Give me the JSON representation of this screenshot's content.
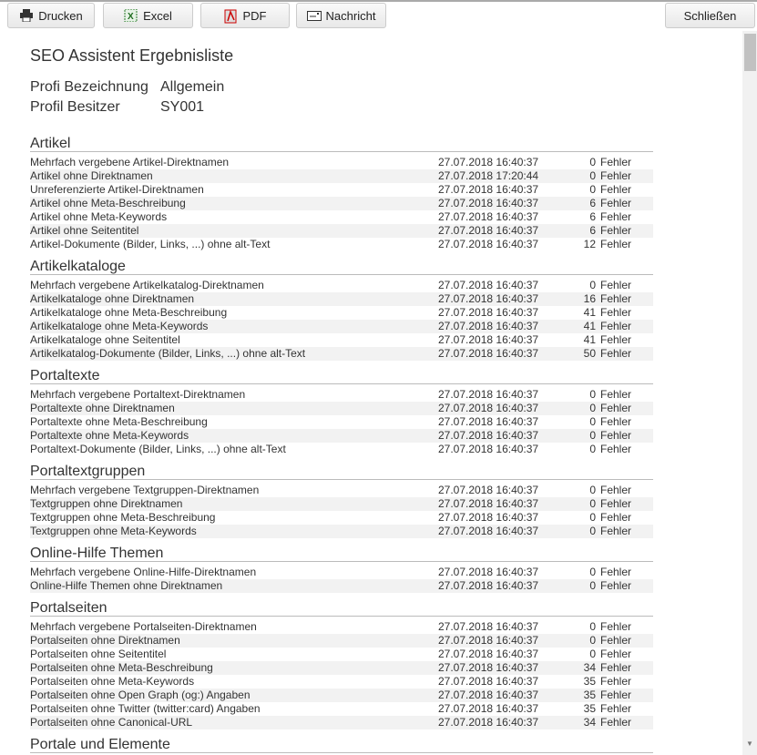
{
  "toolbar": {
    "print": "Drucken",
    "excel": "Excel",
    "pdf": "PDF",
    "message": "Nachricht",
    "close": "Schließen"
  },
  "title": "SEO Assistent Ergebnisliste",
  "profile": [
    {
      "label": "Profi Bezeichnung",
      "value": "Allgemein"
    },
    {
      "label": "Profil Besitzer",
      "value": "SY001"
    }
  ],
  "unit": "Fehler",
  "sections": [
    {
      "title": "Artikel",
      "rows": [
        [
          "Mehrfach vergebene Artikel-Direktnamen",
          "27.07.2018 16:40:37",
          "0"
        ],
        [
          "Artikel ohne Direktnamen",
          "27.07.2018 17:20:44",
          "0"
        ],
        [
          "Unreferenzierte Artikel-Direktnamen",
          "27.07.2018 16:40:37",
          "0"
        ],
        [
          "Artikel ohne Meta-Beschreibung",
          "27.07.2018 16:40:37",
          "6"
        ],
        [
          "Artikel ohne Meta-Keywords",
          "27.07.2018 16:40:37",
          "6"
        ],
        [
          "Artikel ohne Seitentitel",
          "27.07.2018 16:40:37",
          "6"
        ],
        [
          "Artikel-Dokumente (Bilder, Links, ...) ohne alt-Text",
          "27.07.2018 16:40:37",
          "12"
        ]
      ]
    },
    {
      "title": "Artikelkataloge",
      "rows": [
        [
          "Mehrfach vergebene Artikelkatalog-Direktnamen",
          "27.07.2018 16:40:37",
          "0"
        ],
        [
          "Artikelkataloge ohne Direktnamen",
          "27.07.2018 16:40:37",
          "16"
        ],
        [
          "Artikelkataloge ohne Meta-Beschreibung",
          "27.07.2018 16:40:37",
          "41"
        ],
        [
          "Artikelkataloge ohne Meta-Keywords",
          "27.07.2018 16:40:37",
          "41"
        ],
        [
          "Artikelkataloge ohne Seitentitel",
          "27.07.2018 16:40:37",
          "41"
        ],
        [
          "Artikelkatalog-Dokumente (Bilder, Links, ...) ohne alt-Text",
          "27.07.2018 16:40:37",
          "50"
        ]
      ]
    },
    {
      "title": "Portaltexte",
      "rows": [
        [
          "Mehrfach vergebene Portaltext-Direktnamen",
          "27.07.2018 16:40:37",
          "0"
        ],
        [
          "Portaltexte ohne Direktnamen",
          "27.07.2018 16:40:37",
          "0"
        ],
        [
          "Portaltexte ohne Meta-Beschreibung",
          "27.07.2018 16:40:37",
          "0"
        ],
        [
          "Portaltexte ohne Meta-Keywords",
          "27.07.2018 16:40:37",
          "0"
        ],
        [
          "Portaltext-Dokumente (Bilder, Links, ...) ohne alt-Text",
          "27.07.2018 16:40:37",
          "0"
        ]
      ]
    },
    {
      "title": "Portaltextgruppen",
      "rows": [
        [
          "Mehrfach vergebene Textgruppen-Direktnamen",
          "27.07.2018 16:40:37",
          "0"
        ],
        [
          "Textgruppen ohne Direktnamen",
          "27.07.2018 16:40:37",
          "0"
        ],
        [
          "Textgruppen ohne Meta-Beschreibung",
          "27.07.2018 16:40:37",
          "0"
        ],
        [
          "Textgruppen ohne Meta-Keywords",
          "27.07.2018 16:40:37",
          "0"
        ]
      ]
    },
    {
      "title": "Online-Hilfe Themen",
      "rows": [
        [
          "Mehrfach vergebene Online-Hilfe-Direktnamen",
          "27.07.2018 16:40:37",
          "0"
        ],
        [
          "Online-Hilfe Themen ohne Direktnamen",
          "27.07.2018 16:40:37",
          "0"
        ]
      ]
    },
    {
      "title": "Portalseiten",
      "rows": [
        [
          "Mehrfach vergebene Portalseiten-Direktnamen",
          "27.07.2018 16:40:37",
          "0"
        ],
        [
          "Portalseiten ohne Direktnamen",
          "27.07.2018 16:40:37",
          "0"
        ],
        [
          "Portalseiten ohne Seitentitel",
          "27.07.2018 16:40:37",
          "0"
        ],
        [
          "Portalseiten ohne Meta-Beschreibung",
          "27.07.2018 16:40:37",
          "34"
        ],
        [
          "Portalseiten ohne Meta-Keywords",
          "27.07.2018 16:40:37",
          "35"
        ],
        [
          "Portalseiten ohne Open Graph (og:) Angaben",
          "27.07.2018 16:40:37",
          "35"
        ],
        [
          "Portalseiten ohne Twitter (twitter:card) Angaben",
          "27.07.2018 16:40:37",
          "35"
        ],
        [
          "Portalseiten ohne Canonical-URL",
          "27.07.2018 16:40:37",
          "34"
        ]
      ]
    },
    {
      "title": "Portale und Elemente",
      "rows": []
    }
  ]
}
